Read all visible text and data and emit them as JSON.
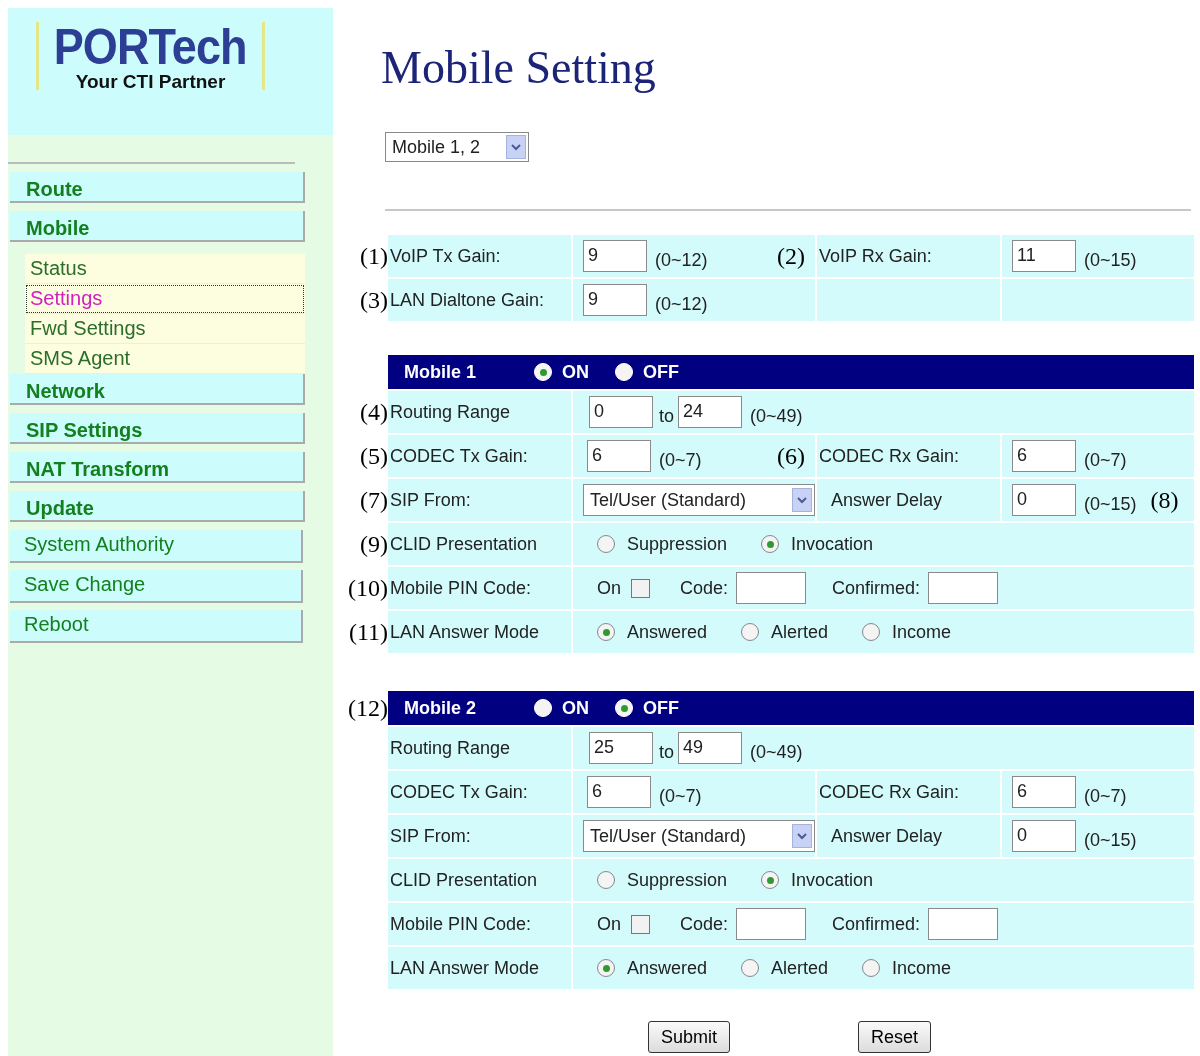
{
  "logo": {
    "brand": "PORTech",
    "tagline": "Your CTI Partner"
  },
  "sidebar": {
    "items": [
      {
        "label": "Route",
        "kind": "main",
        "selected": false
      },
      {
        "label": "Mobile",
        "kind": "main",
        "selected": false
      },
      {
        "label": "Status",
        "kind": "sub",
        "selected": false
      },
      {
        "label": "Settings",
        "kind": "sub",
        "selected": true
      },
      {
        "label": "Fwd Settings",
        "kind": "sub",
        "selected": false
      },
      {
        "label": "SMS Agent",
        "kind": "sub",
        "selected": false
      },
      {
        "label": "Network",
        "kind": "main",
        "selected": false
      },
      {
        "label": "SIP Settings",
        "kind": "main",
        "selected": false
      },
      {
        "label": "NAT Transform",
        "kind": "main",
        "selected": false
      },
      {
        "label": "Update",
        "kind": "main",
        "selected": false
      },
      {
        "label": "System Authority",
        "kind": "plain",
        "selected": false
      },
      {
        "label": "Save Change",
        "kind": "plain",
        "selected": false
      },
      {
        "label": "Reboot",
        "kind": "plain",
        "selected": false
      }
    ]
  },
  "title": "Mobile Setting",
  "mobile_select": "Mobile 1, 2",
  "gain_table": {
    "rows": [
      {
        "callout": "(1)",
        "label": "VoIP Tx Gain:",
        "value": "9",
        "range": "(0~12)",
        "callout_2": "(2)",
        "label_2": "VoIP Rx Gain:",
        "value_2": "11",
        "range_2": "(0~15)"
      },
      {
        "callout": "(3)",
        "label": "LAN Dialtone Gain:",
        "value": "9",
        "range": "(0~12)"
      }
    ]
  },
  "mobiles": [
    {
      "title": "Mobile 1",
      "on": true,
      "on_label": "ON",
      "off_label": "OFF",
      "rows": [
        {
          "kind": "range",
          "callout": "(4)",
          "label": "Routing Range",
          "from": "0",
          "to_label": "to",
          "to": "24",
          "range": "(0~49)"
        },
        {
          "kind": "pair",
          "callout": "(5)",
          "label": "CODEC Tx Gain:",
          "value": "6",
          "range": "(0~7)",
          "callout_2": "(6)",
          "label_2": "CODEC Rx Gain:",
          "value_2": "6",
          "range_2": "(0~7)"
        },
        {
          "kind": "select",
          "callout": "(7)",
          "label": "SIP From:",
          "value": "Tel/User (Standard)",
          "label_2": "Answer Delay",
          "value_2": "0",
          "range_2": "(0~15)",
          "callout_end": "(8)"
        },
        {
          "kind": "radio",
          "callout": "(9)",
          "label": "CLID Presentation",
          "options": [
            {
              "label": "Suppression",
              "selected": false
            },
            {
              "label": "Invocation",
              "selected": true
            }
          ]
        },
        {
          "kind": "pin",
          "callout": "(10)",
          "label": "Mobile PIN Code:",
          "on_label": "On",
          "checked": false,
          "code_label": "Code:",
          "confirmed_label": "Confirmed:"
        },
        {
          "kind": "radio",
          "callout": "(11)",
          "label": "LAN Answer Mode",
          "options": [
            {
              "label": "Answered",
              "selected": true
            },
            {
              "label": "Alerted",
              "selected": false
            },
            {
              "label": "Income",
              "selected": false
            }
          ]
        }
      ]
    },
    {
      "callout": "(12)",
      "title": "Mobile 2",
      "on": false,
      "on_label": "ON",
      "off_label": "OFF",
      "rows": [
        {
          "kind": "range",
          "label": "Routing Range",
          "from": "25",
          "to_label": "to",
          "to": "49",
          "range": "(0~49)"
        },
        {
          "kind": "pair",
          "label": "CODEC Tx Gain:",
          "value": "6",
          "range": "(0~7)",
          "label_2": "CODEC Rx Gain:",
          "value_2": "6",
          "range_2": "(0~7)"
        },
        {
          "kind": "select",
          "label": "SIP From:",
          "value": "Tel/User (Standard)",
          "label_2": "Answer Delay",
          "value_2": "0",
          "range_2": "(0~15)"
        },
        {
          "kind": "radio",
          "label": "CLID Presentation",
          "options": [
            {
              "label": "Suppression",
              "selected": false
            },
            {
              "label": "Invocation",
              "selected": true
            }
          ]
        },
        {
          "kind": "pin",
          "label": "Mobile PIN Code:",
          "on_label": "On",
          "checked": false,
          "code_label": "Code:",
          "confirmed_label": "Confirmed:"
        },
        {
          "kind": "radio",
          "label": "LAN Answer Mode",
          "options": [
            {
              "label": "Answered",
              "selected": true
            },
            {
              "label": "Alerted",
              "selected": false
            },
            {
              "label": "Income",
              "selected": false
            }
          ]
        }
      ]
    }
  ],
  "buttons": [
    "Submit",
    "Reset"
  ]
}
